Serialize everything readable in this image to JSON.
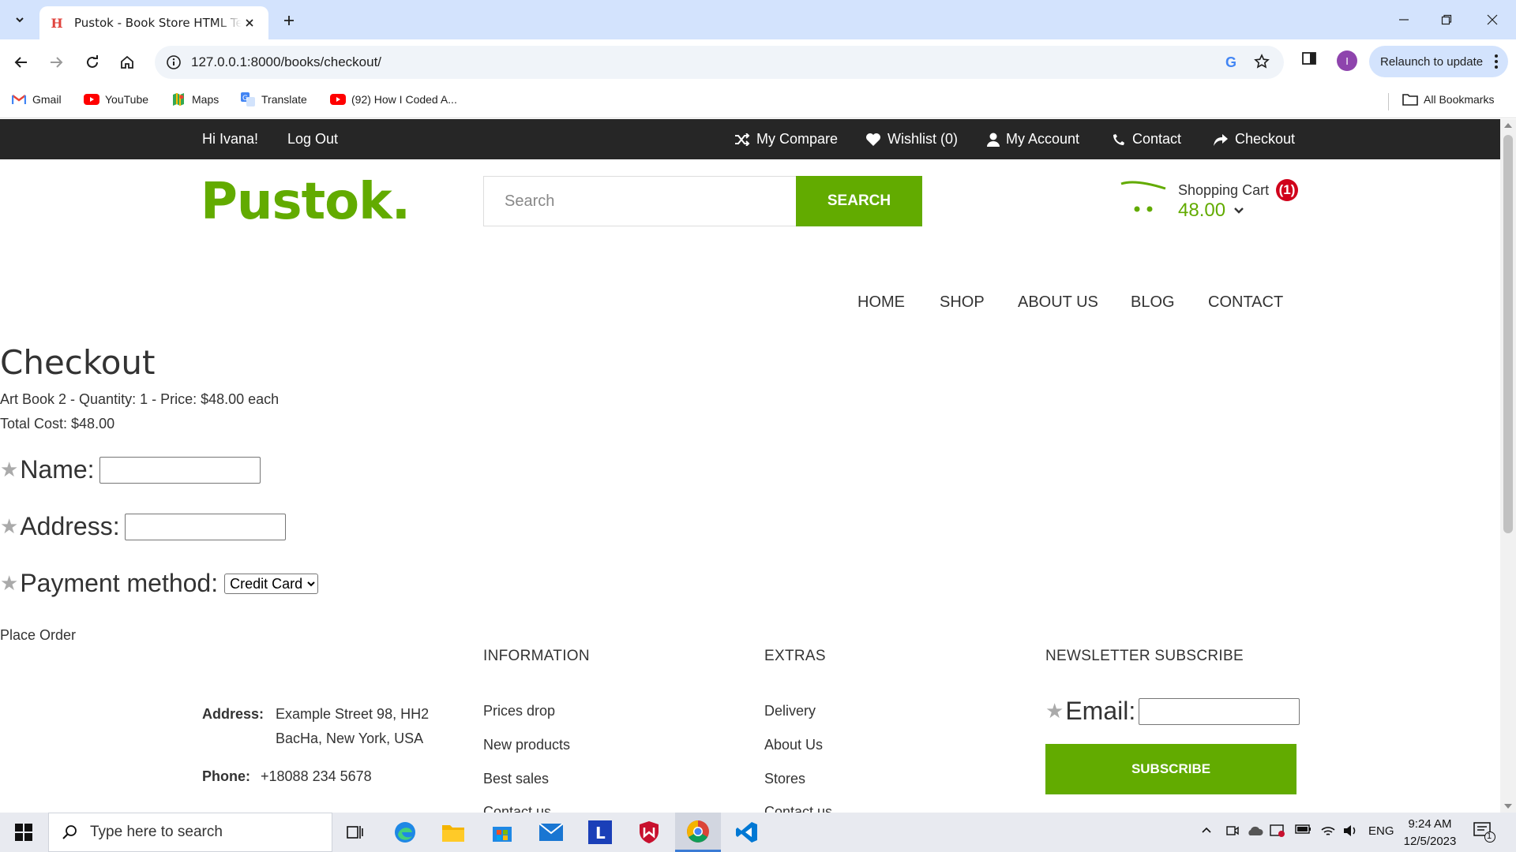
{
  "browser": {
    "tab_title": "Pustok - Book Store HTML Template",
    "url": "127.0.0.1:8000/books/checkout/",
    "relaunch_label": "Relaunch to update",
    "profile_initial": "I",
    "bookmarks": [
      {
        "label": "Gmail",
        "icon": "gmail-icon"
      },
      {
        "label": "YouTube",
        "icon": "youtube-icon"
      },
      {
        "label": "Maps",
        "icon": "maps-icon"
      },
      {
        "label": "Translate",
        "icon": "translate-icon"
      },
      {
        "label": "(92) How I Coded A...",
        "icon": "youtube-icon"
      }
    ],
    "all_bookmarks_label": "All Bookmarks"
  },
  "topbar": {
    "greeting": "Hi Ivana!",
    "logout": "Log Out",
    "links": [
      {
        "label": "My Compare",
        "icon": "shuffle-icon"
      },
      {
        "label": "Wishlist (0)",
        "icon": "heart-icon"
      },
      {
        "label": "My Account",
        "icon": "user-icon"
      },
      {
        "label": "Contact",
        "icon": "phone-icon"
      },
      {
        "label": "Checkout",
        "icon": "share-icon"
      }
    ]
  },
  "header": {
    "logo": "Pustok.",
    "search_placeholder": "Search",
    "search_button": "SEARCH",
    "cart_label": "Shopping Cart",
    "cart_count": "1",
    "cart_total": "48.00",
    "brand_color": "#62ab00"
  },
  "nav": [
    "HOME",
    "SHOP",
    "ABOUT US",
    "BLOG",
    "CONTACT"
  ],
  "checkout": {
    "title": "Checkout",
    "line_item": "Art Book 2 - Quantity: 1 - Price: $48.00 each",
    "total_cost": "Total Cost: $48.00",
    "name_label": "Name:",
    "address_label": "Address:",
    "payment_label": "Payment method:",
    "payment_selected": "Credit Card",
    "place_order": "Place Order"
  },
  "footer": {
    "address_label": "Address:",
    "address_line1": "Example Street 98, HH2",
    "address_line2": "BacHa, New York, USA",
    "phone_label": "Phone:",
    "phone_value": "+18088 234 5678",
    "information": {
      "heading": "INFORMATION",
      "links": [
        "Prices drop",
        "New products",
        "Best sales",
        "Contact us"
      ]
    },
    "extras": {
      "heading": "EXTRAS",
      "links": [
        "Delivery",
        "About Us",
        "Stores",
        "Contact us"
      ]
    },
    "newsletter": {
      "heading": "NEWSLETTER SUBSCRIBE",
      "email_label": "Email:",
      "subscribe_button": "SUBSCRIBE"
    }
  },
  "taskbar": {
    "search_placeholder": "Type here to search",
    "language": "ENG",
    "time": "9:24 AM",
    "date": "12/5/2023",
    "notification_count": "1"
  }
}
